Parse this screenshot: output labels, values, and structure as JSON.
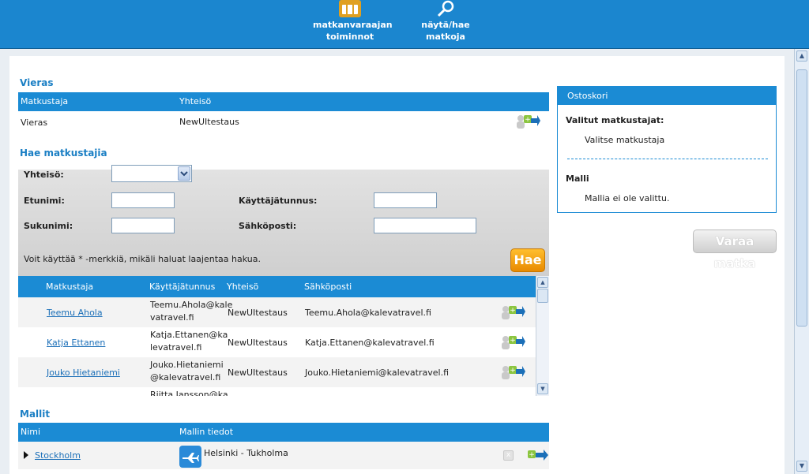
{
  "nav": {
    "booker_line1": "matkanvaraajan",
    "booker_line2": "toiminnot",
    "search_trips": "näytä/hae matkoja"
  },
  "guest": {
    "title": "Vieras",
    "headers": [
      "Matkustaja",
      "Yhteisö"
    ],
    "row": {
      "traveller": "Vieras",
      "community": "NewUItestaus"
    }
  },
  "search": {
    "title": "Hae matkustajia",
    "community_label": "Yhteisö:",
    "firstname_label": "Etunimi:",
    "username_label": "Käyttäjätunnus:",
    "lastname_label": "Sukunimi:",
    "email_label": "Sähköposti:",
    "hint": "Voit käyttää * -merkkiä, mikäli haluat laajentaa hakua.",
    "button": "Hae"
  },
  "results": {
    "headers": [
      "Matkustaja",
      "Käyttäjätunnus",
      "Yhteisö",
      "Sähköposti"
    ],
    "rows": [
      {
        "name": "Teemu Ahola",
        "user1": "Teemu.Ahola@kale",
        "user2": "vatravel.fi",
        "community": "NewUItestaus",
        "email": "Teemu.Ahola@kalevatravel.fi"
      },
      {
        "name": "Katja Ettanen",
        "user1": "Katja.Ettanen@ka",
        "user2": "levatravel.fi",
        "community": "NewUItestaus",
        "email": "Katja.Ettanen@kalevatravel.fi"
      },
      {
        "name": "Jouko Hietaniemi",
        "user1": "Jouko.Hietaniemi",
        "user2": "@kalevatravel.fi",
        "community": "NewUItestaus",
        "email": "Jouko.Hietaniemi@kalevatravel.fi"
      },
      {
        "name": "",
        "user1": "Riitta.Jansson@ka",
        "user2": "",
        "community": "",
        "email": ""
      }
    ]
  },
  "templates": {
    "title": "Mallit",
    "headers": [
      "Nimi",
      "Mallin tiedot"
    ],
    "row": {
      "name": "Stockholm",
      "details": "Helsinki - Tukholma"
    }
  },
  "cart": {
    "title": "Ostoskori",
    "selected_label": "Valitut matkustajat:",
    "selected_value": "Valitse matkustaja",
    "template_label": "Malli",
    "template_value": "Mallia ei ole valittu.",
    "book_button": "Varaa matka"
  },
  "colors": {
    "accent": "#1b8bd4",
    "button_orange": "#f5a000"
  }
}
